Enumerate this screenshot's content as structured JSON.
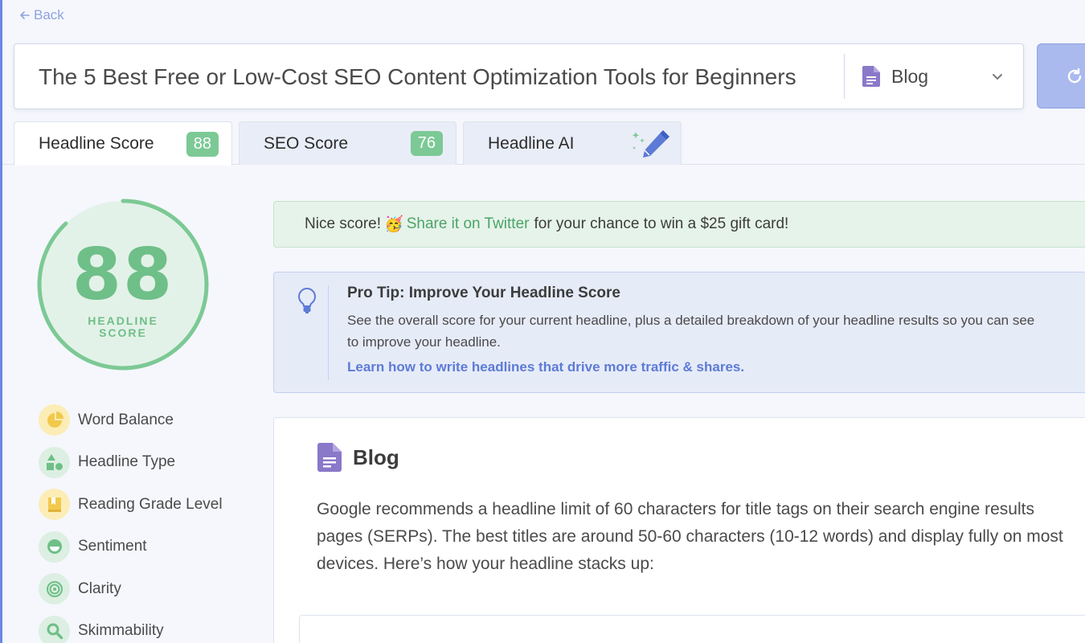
{
  "nav": {
    "back_label": "Back"
  },
  "headline_input": {
    "value": "The 5 Best Free or Low-Cost SEO Content Optimization Tools for Beginners"
  },
  "type_select": {
    "selected": "Blog"
  },
  "tabs": [
    {
      "label": "Headline Score",
      "badge": "88"
    },
    {
      "label": "SEO Score",
      "badge": "76"
    },
    {
      "label": "Headline AI"
    }
  ],
  "score": {
    "value": "88",
    "label_line1": "HEADLINE",
    "label_line2": "SCORE",
    "fraction": 0.88
  },
  "metrics": [
    {
      "label": "Word Balance",
      "icon": "pie-chart-icon"
    },
    {
      "label": "Headline Type",
      "icon": "shapes-icon"
    },
    {
      "label": "Reading Grade Level",
      "icon": "bookmark-book-icon"
    },
    {
      "label": "Sentiment",
      "icon": "smile-icon"
    },
    {
      "label": "Clarity",
      "icon": "target-icon"
    },
    {
      "label": "Skimmability",
      "icon": "magnifier-icon"
    }
  ],
  "share_banner": {
    "prefix": "Nice score!",
    "emoji": "🥳",
    "link": "Share it on Twitter",
    "suffix": "for your chance to win a $25 gift card!"
  },
  "pro_tip": {
    "title": "Pro Tip: Improve Your Headline Score",
    "body_line1": "See the overall score for your current headline, plus a detailed breakdown of your headline results so you can see",
    "body_line2": "to improve your headline.",
    "link": "Learn how to write headlines that drive more traffic & shares."
  },
  "blog_card": {
    "title": "Blog",
    "line1": "Google recommends a headline limit of 60 characters for title tags on their search engine results",
    "line2": "pages (SERPs). The best titles are around 50-60 characters (10-12 words) and display fully on most",
    "line3": "devices. Here’s how your headline stacks up:"
  },
  "colors": {
    "accent_green": "#6fbf88",
    "accent_blue": "#5d7bd6",
    "badge_green": "#7cc995",
    "doc_purple": "#8a78c9"
  }
}
